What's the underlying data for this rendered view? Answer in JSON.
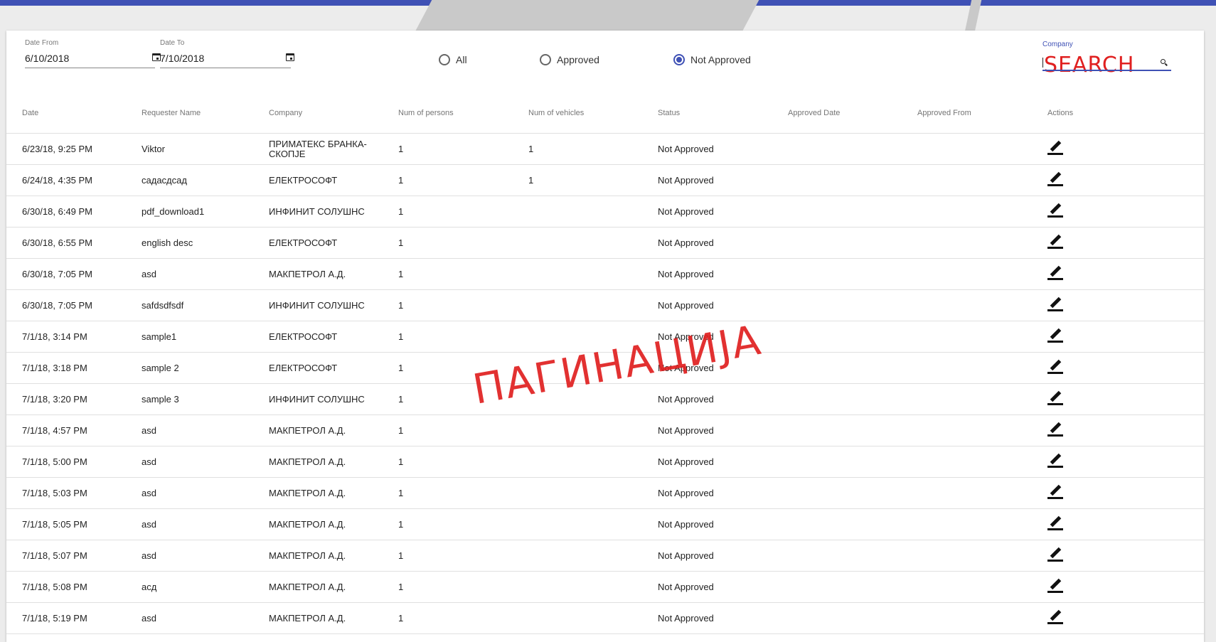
{
  "filters": {
    "date_from_label": "Date From",
    "date_from_value": "6/10/2018",
    "date_to_label": "Date To",
    "date_to_value": "7/10/2018",
    "radio_all": "All",
    "radio_approved": "Approved",
    "radio_not_approved": "Not Approved",
    "selected_radio": "Not Approved",
    "company_label": "Company",
    "company_scribble": "SEARCH"
  },
  "table": {
    "headers": [
      "Date",
      "Requester Name",
      "Company",
      "Num of persons",
      "Num of vehicles",
      "Status",
      "Approved Date",
      "Approved From",
      "Actions"
    ],
    "rows": [
      [
        "6/23/18, 9:25 PM",
        "Viktor",
        "ПРИМАТЕКС БРАНКА-СКОПЈЕ",
        "1",
        "1",
        "Not Approved",
        "",
        ""
      ],
      [
        "6/24/18, 4:35 PM",
        "садасдсад",
        "ЕЛЕКТРОСОФТ",
        "1",
        "1",
        "Not Approved",
        "",
        ""
      ],
      [
        "6/30/18, 6:49 PM",
        "pdf_download1",
        "ИНФИНИТ СОЛУШНС",
        "1",
        "",
        "Not Approved",
        "",
        ""
      ],
      [
        "6/30/18, 6:55 PM",
        "english desc",
        "ЕЛЕКТРОСОФТ",
        "1",
        "",
        "Not Approved",
        "",
        ""
      ],
      [
        "6/30/18, 7:05 PM",
        "asd",
        "МАКПЕТРОЛ А.Д.",
        "1",
        "",
        "Not Approved",
        "",
        ""
      ],
      [
        "6/30/18, 7:05 PM",
        "safdsdfsdf",
        "ИНФИНИТ СОЛУШНС",
        "1",
        "",
        "Not Approved",
        "",
        ""
      ],
      [
        "7/1/18, 3:14 PM",
        "sample1",
        "ЕЛЕКТРОСОФТ",
        "1",
        "",
        "Not Approved",
        "",
        ""
      ],
      [
        "7/1/18, 3:18 PM",
        "sample 2",
        "ЕЛЕКТРОСОФТ",
        "1",
        "",
        "Not Approved",
        "",
        ""
      ],
      [
        "7/1/18, 3:20 PM",
        "sample 3",
        "ИНФИНИТ СОЛУШНС",
        "1",
        "",
        "Not Approved",
        "",
        ""
      ],
      [
        "7/1/18, 4:57 PM",
        "asd",
        "МАКПЕТРОЛ А.Д.",
        "1",
        "",
        "Not Approved",
        "",
        ""
      ],
      [
        "7/1/18, 5:00 PM",
        "asd",
        "МАКПЕТРОЛ А.Д.",
        "1",
        "",
        "Not Approved",
        "",
        ""
      ],
      [
        "7/1/18, 5:03 PM",
        "asd",
        "МАКПЕТРОЛ А.Д.",
        "1",
        "",
        "Not Approved",
        "",
        ""
      ],
      [
        "7/1/18, 5:05 PM",
        "asd",
        "МАКПЕТРОЛ А.Д.",
        "1",
        "",
        "Not Approved",
        "",
        ""
      ],
      [
        "7/1/18, 5:07 PM",
        "asd",
        "МАКПЕТРОЛ А.Д.",
        "1",
        "",
        "Not Approved",
        "",
        ""
      ],
      [
        "7/1/18, 5:08 PM",
        "асд",
        "МАКПЕТРОЛ А.Д.",
        "1",
        "",
        "Not Approved",
        "",
        ""
      ],
      [
        "7/1/18, 5:19 PM",
        "asd",
        "МАКПЕТРОЛ А.Д.",
        "1",
        "",
        "Not Approved",
        "",
        ""
      ]
    ],
    "action_icon": "edit-icon"
  },
  "annotation": {
    "text": "ПАГИНАЦИЈА"
  },
  "colors": {
    "accent": "#3f51b5",
    "annotation": "#e02020"
  }
}
